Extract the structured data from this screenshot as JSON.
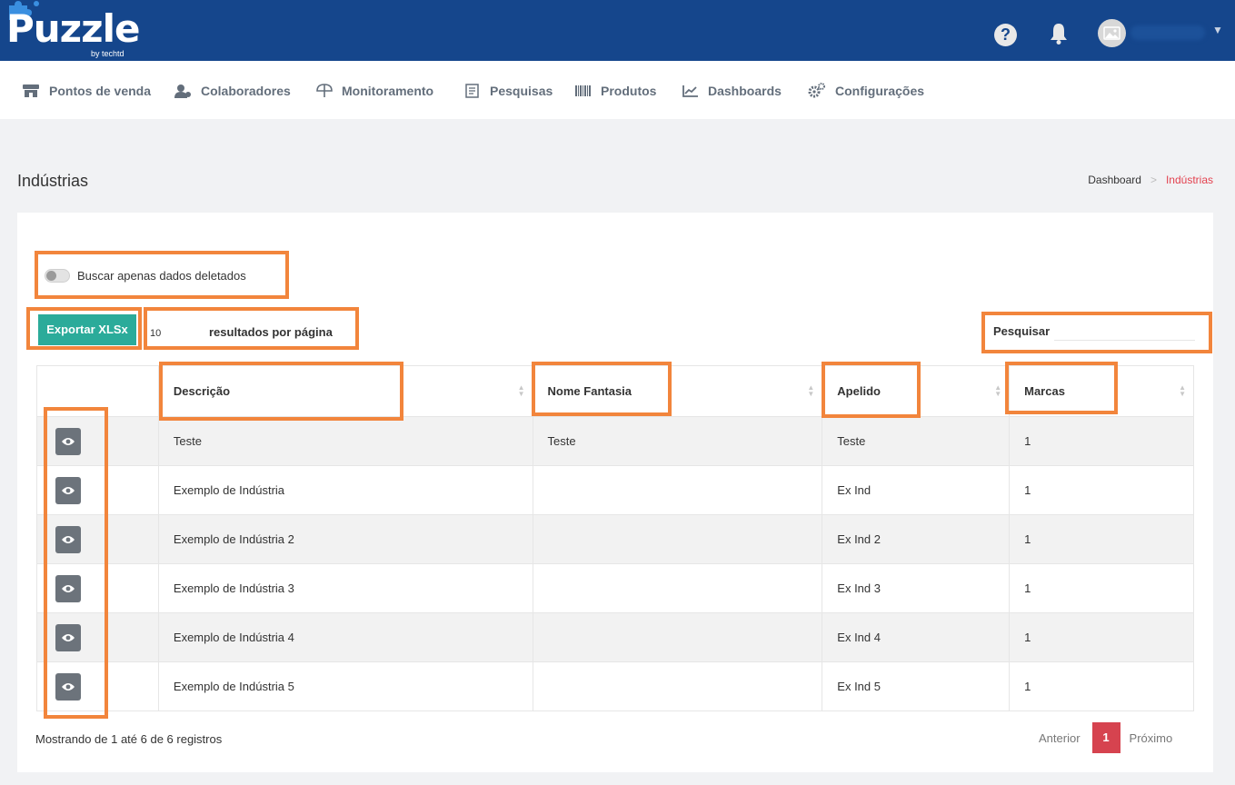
{
  "header": {
    "logo_text": "Puzzle",
    "logo_by": "by techtd",
    "help_label": "?"
  },
  "nav": {
    "items": [
      {
        "label": "Pontos de venda",
        "icon": "store-icon"
      },
      {
        "label": "Colaboradores",
        "icon": "users-icon"
      },
      {
        "label": "Monitoramento",
        "icon": "umbrella-icon"
      },
      {
        "label": "Pesquisas",
        "icon": "survey-icon"
      },
      {
        "label": "Produtos",
        "icon": "barcode-icon"
      },
      {
        "label": "Dashboards",
        "icon": "chart-icon"
      },
      {
        "label": "Configurações",
        "icon": "gears-icon"
      }
    ]
  },
  "page": {
    "title": "Indústrias",
    "breadcrumb": {
      "home": "Dashboard",
      "separator": ">",
      "current": "Indústrias"
    }
  },
  "filters": {
    "deleted_toggle_label": "Buscar apenas dados deletados",
    "export_label": "Exportar XLSx",
    "page_size_value": "10",
    "page_size_label": "resultados por página",
    "search_label": "Pesquisar",
    "search_value": ""
  },
  "table": {
    "columns": [
      "",
      "Descrição",
      "Nome Fantasia",
      "Apelido",
      "Marcas"
    ],
    "rows": [
      {
        "descricao": "Teste",
        "nome_fantasia": "Teste",
        "apelido": "Teste",
        "marcas": "1"
      },
      {
        "descricao": "Exemplo de Indústria",
        "nome_fantasia": "",
        "apelido": "Ex Ind",
        "marcas": "1"
      },
      {
        "descricao": "Exemplo de Indústria 2",
        "nome_fantasia": "",
        "apelido": "Ex Ind 2",
        "marcas": "1"
      },
      {
        "descricao": "Exemplo de Indústria 3",
        "nome_fantasia": "",
        "apelido": "Ex Ind 3",
        "marcas": "1"
      },
      {
        "descricao": "Exemplo de Indústria 4",
        "nome_fantasia": "",
        "apelido": "Ex Ind 4",
        "marcas": "1"
      },
      {
        "descricao": "Exemplo de Indústria 5",
        "nome_fantasia": "",
        "apelido": "Ex Ind 5",
        "marcas": "1"
      }
    ]
  },
  "footer": {
    "info": "Mostrando de 1 até 6 de 6 registros",
    "prev_label": "Anterior",
    "current_page": "1",
    "next_label": "Próximo"
  },
  "colors": {
    "topbar": "#15468c",
    "export_button": "#2bab9a",
    "active_page": "#d6434f",
    "highlight": "#f2853c",
    "breadcrumb_current": "#e3424f"
  }
}
